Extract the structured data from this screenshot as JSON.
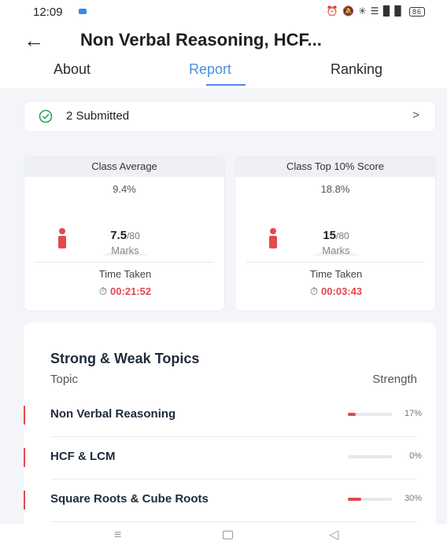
{
  "status_bar": {
    "time": "12:09",
    "icons": "⏰ 🔕 ✳ ☰ ▉ ▉",
    "battery": "86"
  },
  "header": {
    "title": "Non Verbal Reasoning, HCF..."
  },
  "tabs": {
    "about": "About",
    "report": "Report",
    "ranking": "Ranking",
    "active": "Report"
  },
  "submitted": {
    "label": "2 Submitted",
    "chevron": ">"
  },
  "class_average": {
    "title": "Class Average",
    "percent": "9.4%",
    "score": "7.5",
    "total": "/80",
    "unit": "Marks",
    "time_label": "Time Taken",
    "time": "00:21:52",
    "gauge_fraction": 0.094
  },
  "class_top": {
    "title": "Class Top 10% Score",
    "percent": "18.8%",
    "score": "15",
    "total": "/80",
    "unit": "Marks",
    "time_label": "Time Taken",
    "time": "00:03:43",
    "gauge_fraction": 0.188
  },
  "topics": {
    "title": "Strong & Weak Topics",
    "col_topic": "Topic",
    "col_strength": "Strength",
    "rows": [
      {
        "name": "Non Verbal Reasoning",
        "pct_label": "17%",
        "value": 17
      },
      {
        "name": "HCF & LCM",
        "pct_label": "0%",
        "value": 0
      },
      {
        "name": "Square Roots & Cube Roots",
        "pct_label": "30%",
        "value": 30
      }
    ]
  },
  "colors": {
    "accent": "#4a8de8",
    "danger": "#e5484d",
    "success": "#22a45d"
  },
  "nav": {
    "menu_icon": "≡",
    "back_icon": "◁"
  }
}
